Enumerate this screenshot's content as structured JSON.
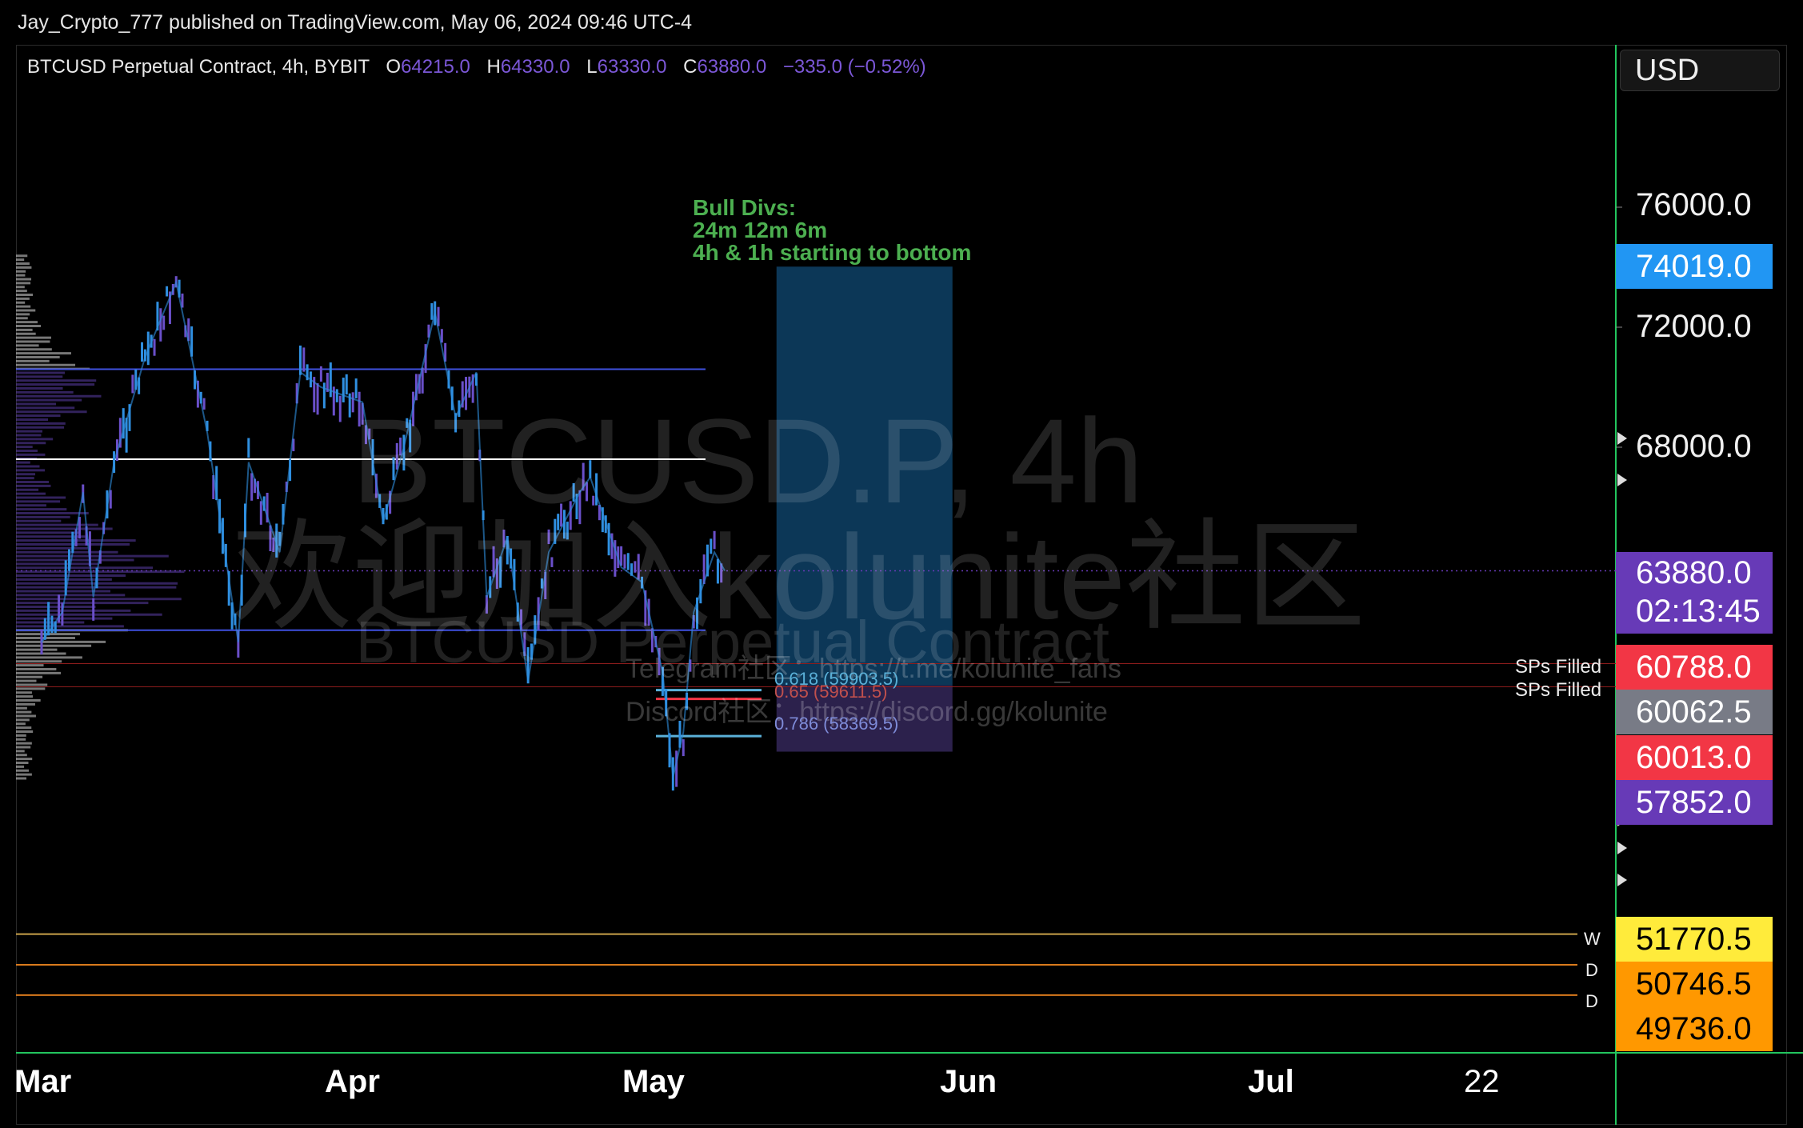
{
  "publisher": "Jay_Crypto_777 published on TradingView.com, May 06, 2024 09:46 UTC-4",
  "legend": {
    "symbol": "BTCUSD Perpetual Contract, 4h, BYBIT",
    "open_key": "O",
    "open": "64215.0",
    "high_key": "H",
    "high": "64330.0",
    "low_key": "L",
    "low": "63330.0",
    "close_key": "C",
    "close": "63880.0",
    "change": "−335.0 (−0.52%)"
  },
  "currency": "USD",
  "annotation": [
    "Bull Divs:",
    "24m 12m 6m",
    "4h & 1h starting to bottom"
  ],
  "watermark": {
    "line1": "BTCUSD.P, 4h",
    "line2": "欢迎加入kolunite社区",
    "line3": "BTCUSD Perpetual Contract",
    "telegram": "Telegram社区：https://t.me/kolunite_fans",
    "discord": "Discord社区：https://discord.gg/kolunite"
  },
  "fib_labels": [
    "0.618 (59903.5)",
    "0.65 (59611.5)",
    "0.786 (58369.5)"
  ],
  "sp_labels": [
    "SPs Filled",
    "SPs Filled"
  ],
  "level_letters": [
    "W",
    "D",
    "D"
  ],
  "price_tags": [
    {
      "value": "74019.0",
      "color": "#2196f3"
    },
    {
      "value": "63880.0",
      "sub": "02:13:45",
      "color": "#673ab7"
    },
    {
      "value": "60788.0",
      "color": "#f23645"
    },
    {
      "value": "60062.5",
      "color": "#787b86"
    },
    {
      "value": "60013.0",
      "color": "#f23645"
    },
    {
      "value": "57852.0",
      "color": "#673ab7"
    },
    {
      "value": "51770.5",
      "color": "#ffeb3b"
    },
    {
      "value": "50746.5",
      "color": "#ff9800"
    },
    {
      "value": "49736.0",
      "color": "#ff9800"
    }
  ],
  "chart_data": {
    "type": "candlestick",
    "title": "BTCUSD Perpetual Contract, 4h, BYBIT",
    "y_ticks": [
      "76000.0",
      "72000.0",
      "68000.0"
    ],
    "x_ticks": [
      "Mar",
      "Apr",
      "May",
      "Jun",
      "Jul",
      "22"
    ],
    "ylim": [
      48500,
      78500
    ],
    "price_path": [
      {
        "date": "2024-03-01",
        "price": 61500
      },
      {
        "date": "2024-03-03",
        "price": 62500
      },
      {
        "date": "2024-03-05",
        "price": 66500
      },
      {
        "date": "2024-03-06",
        "price": 63000
      },
      {
        "date": "2024-03-08",
        "price": 67500
      },
      {
        "date": "2024-03-11",
        "price": 71000
      },
      {
        "date": "2024-03-14",
        "price": 73500
      },
      {
        "date": "2024-03-17",
        "price": 68500
      },
      {
        "date": "2024-03-20",
        "price": 61500
      },
      {
        "date": "2024-03-21",
        "price": 67500
      },
      {
        "date": "2024-03-24",
        "price": 64500
      },
      {
        "date": "2024-03-26",
        "price": 70500
      },
      {
        "date": "2024-03-28",
        "price": 70000
      },
      {
        "date": "2024-04-01",
        "price": 69500
      },
      {
        "date": "2024-04-03",
        "price": 65500
      },
      {
        "date": "2024-04-05",
        "price": 68000
      },
      {
        "date": "2024-04-08",
        "price": 72500
      },
      {
        "date": "2024-04-10",
        "price": 69000
      },
      {
        "date": "2024-04-12",
        "price": 70500
      },
      {
        "date": "2024-04-13",
        "price": 63000
      },
      {
        "date": "2024-04-15",
        "price": 65000
      },
      {
        "date": "2024-04-17",
        "price": 60200
      },
      {
        "date": "2024-04-19",
        "price": 64500
      },
      {
        "date": "2024-04-22",
        "price": 66500
      },
      {
        "date": "2024-04-23",
        "price": 67000
      },
      {
        "date": "2024-04-26",
        "price": 64000
      },
      {
        "date": "2024-04-28",
        "price": 63500
      },
      {
        "date": "2024-04-30",
        "price": 60500
      },
      {
        "date": "2024-05-01",
        "price": 57000
      },
      {
        "date": "2024-05-02",
        "price": 58500
      },
      {
        "date": "2024-05-03",
        "price": 62500
      },
      {
        "date": "2024-05-04",
        "price": 63500
      },
      {
        "date": "2024-05-05",
        "price": 64500
      },
      {
        "date": "2024-05-06",
        "price": 63880
      }
    ],
    "horizontal_levels": [
      70600,
      67600,
      61900,
      60788,
      60013,
      51770.5,
      50746.5,
      49736
    ],
    "long_position": {
      "start": "2024-05-11",
      "end": "2024-05-28",
      "target": 74019,
      "entry": 60062.5,
      "stop": 57852
    },
    "fib_levels": {
      "0.618": 59903.5,
      "0.65": 59611.5,
      "0.786": 58369.5
    },
    "current_price": 63880
  }
}
